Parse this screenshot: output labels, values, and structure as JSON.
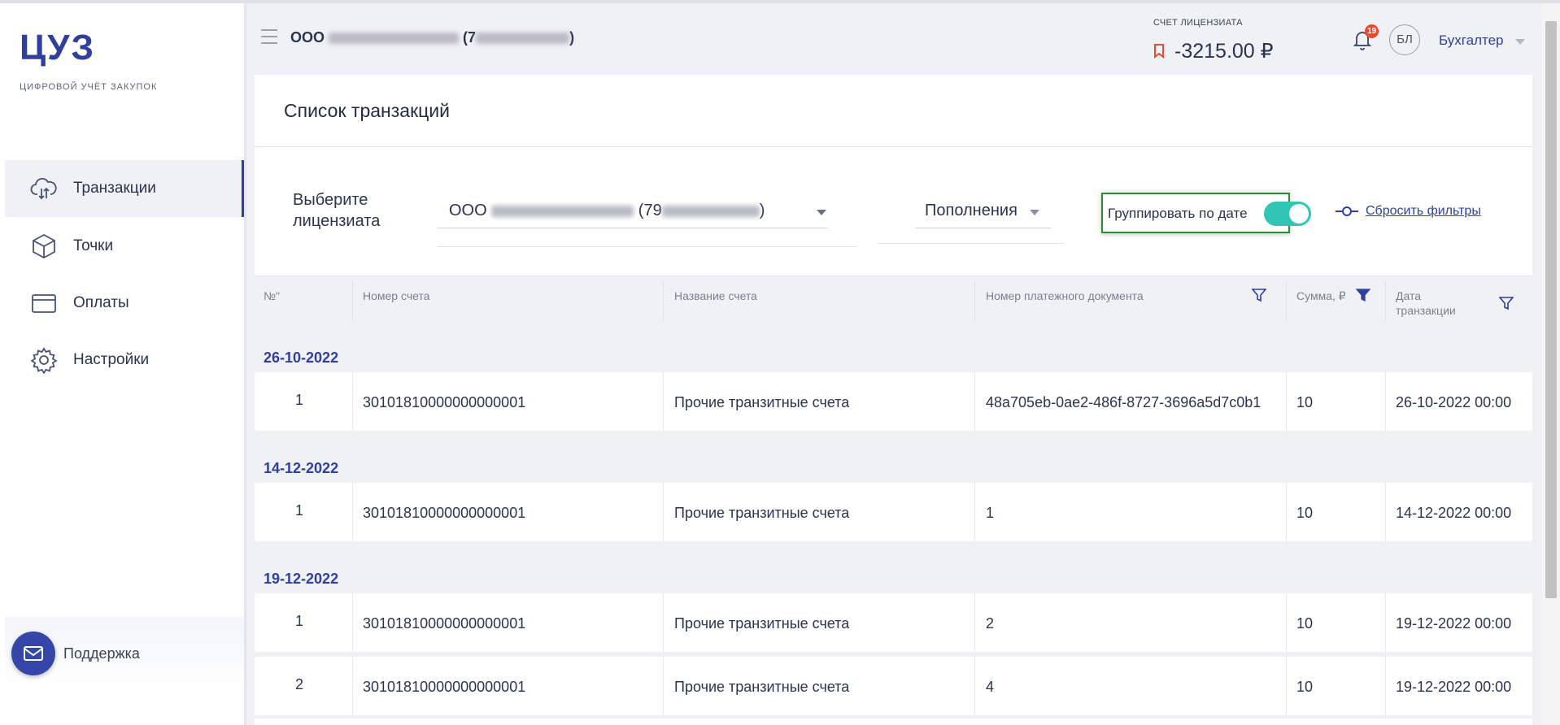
{
  "app": {
    "logo": "ЦУЗ",
    "logo_sub": "ЦИФРОВОЙ УЧЁТ ЗАКУПОК"
  },
  "sidebar": {
    "items": [
      {
        "label": "Транзакции",
        "icon": "cloud-transfer-icon",
        "active": true
      },
      {
        "label": "Точки",
        "icon": "box-icon",
        "active": false
      },
      {
        "label": "Оплаты",
        "icon": "credit-card-icon",
        "active": false
      },
      {
        "label": "Настройки",
        "icon": "gear-icon",
        "active": false
      }
    ],
    "support_label": "Поддержка"
  },
  "header": {
    "org_prefix": "ООО",
    "org_paren_open": "(7",
    "org_paren_close": ")",
    "balance_label": "СЧЕТ ЛИЦЕНЗИАТА",
    "balance_value": "-3215.00 ₽",
    "notifications_count": "19",
    "avatar_initials": "БЛ",
    "role": "Бухгалтер"
  },
  "page": {
    "title": "Список транзакций"
  },
  "filters": {
    "licensee_label": "Выберите лицензиата",
    "licensee_prefix": "ООО",
    "licensee_paren_open": "(79",
    "licensee_paren_close": ")",
    "type_value": "Пополнения",
    "group_label": "Группировать по дате",
    "group_enabled": true,
    "reset_label": "Сбросить фильтры"
  },
  "table": {
    "headers": {
      "num": "№\"",
      "account_number": "Номер счета",
      "account_name": "Название счета",
      "payment_doc": "Номер платежного документа",
      "amount": "Сумма, ₽",
      "date_line1": "Дата",
      "date_line2": "транзакции"
    },
    "groups": [
      {
        "date": "26-10-2022",
        "rows": [
          {
            "num": "1",
            "account_number": "30101810000000000001",
            "account_name": "Прочие транзитные счета",
            "payment_doc": "48a705eb-0ae2-486f-8727-3696a5d7c0b1",
            "amount": "10",
            "date": "26-10-2022 00:00"
          }
        ]
      },
      {
        "date": "14-12-2022",
        "rows": [
          {
            "num": "1",
            "account_number": "30101810000000000001",
            "account_name": "Прочие транзитные счета",
            "payment_doc": "1",
            "amount": "10",
            "date": "14-12-2022 00:00"
          }
        ]
      },
      {
        "date": "19-12-2022",
        "rows": [
          {
            "num": "1",
            "account_number": "30101810000000000001",
            "account_name": "Прочие транзитные счета",
            "payment_doc": "2",
            "amount": "10",
            "date": "19-12-2022 00:00"
          },
          {
            "num": "2",
            "account_number": "30101810000000000001",
            "account_name": "Прочие транзитные счета",
            "payment_doc": "4",
            "amount": "10",
            "date": "19-12-2022 00:00"
          }
        ]
      }
    ]
  },
  "colors": {
    "brand": "#2f3f9e",
    "toggle_on": "#2fc6b4",
    "badge": "#e94b2c",
    "highlight_border": "#2e8b2e"
  }
}
